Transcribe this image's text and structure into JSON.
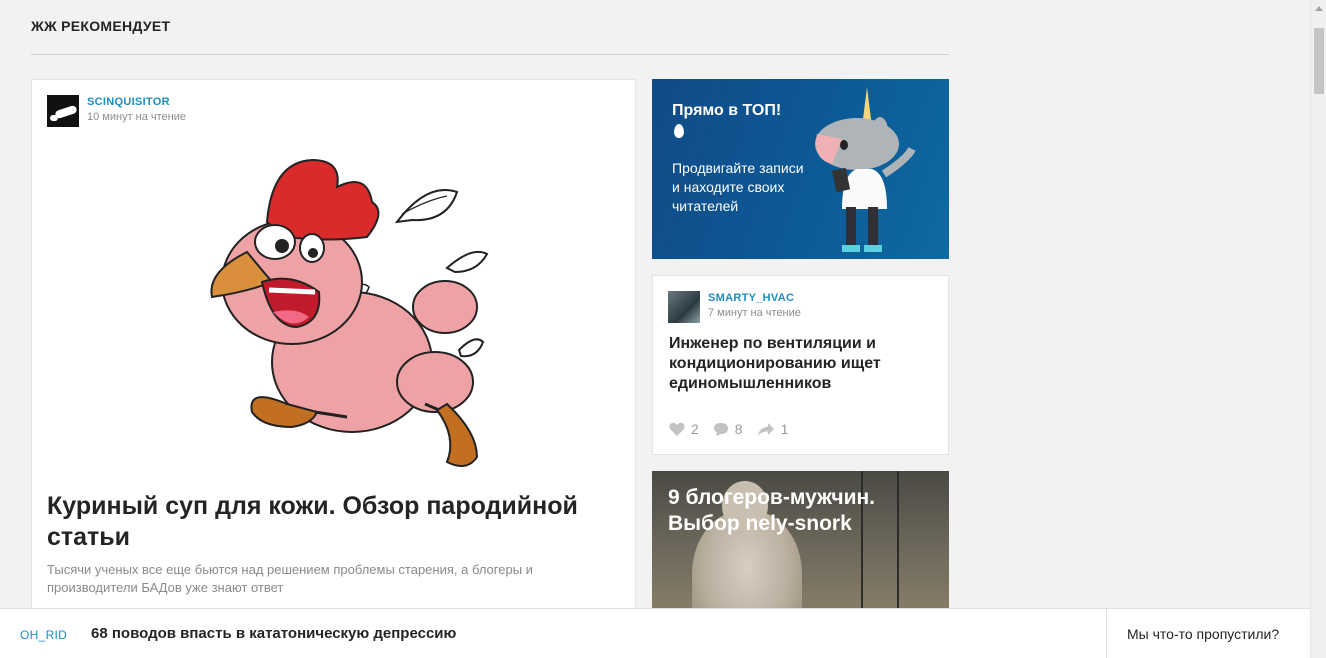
{
  "section": {
    "title": "ЖЖ РЕКОМЕНДУЕТ"
  },
  "main_post": {
    "author": "SCINQUISITOR",
    "read_time": "10 минут на чтение",
    "title": "Куриный суп для кожи. Обзор пародийной статьи",
    "description": "Тысячи ученых все еще бьются над решением проблемы старения, а блогеры и производители БАДов уже знают ответ"
  },
  "promo": {
    "title": "Прямо в ТОП!",
    "text": "Продвигайте записи и находите своих читателей",
    "bg_color": "#0c5a96"
  },
  "small_post": {
    "author": "SMARTY_HVAC",
    "read_time": "7 минут на чтение",
    "title": "Инженер по вентиляции и кондиционированию ищет единомышленников",
    "likes": "2",
    "comments": "8",
    "shares": "1"
  },
  "photo_post": {
    "title": "9 блогеров-мужчин. Выбор nely-snork"
  },
  "bottom_bar": {
    "user": "OH_RID",
    "title": "68 поводов впасть в кататоническую депрессию",
    "missed": "Мы что-то пропустили?"
  },
  "colors": {
    "accent": "#1d8dc0",
    "text": "#242424",
    "muted": "#8a8a8a"
  },
  "icons": [
    "heart-icon",
    "comment-icon",
    "share-icon",
    "fire-icon",
    "unicorn-mascot"
  ]
}
